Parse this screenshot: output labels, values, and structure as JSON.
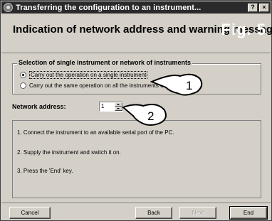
{
  "window": {
    "title": "Transferring the configuration to an instrument...",
    "help_label": "?",
    "close_label": "×"
  },
  "header": {
    "title": "Indication of network address and warning message",
    "figure_label": "Fig. 5"
  },
  "selection": {
    "legend": "Selection of single instrument or network of instruments",
    "options": [
      {
        "label": "Carry out the operation on a single instrument",
        "checked": true
      },
      {
        "label": "Carry out the same operation on all the instruments of network",
        "checked": false
      }
    ]
  },
  "network": {
    "label": "Network address:",
    "value": "1"
  },
  "steps": [
    "1.  Connect the instrument to an available serial port of the PC.",
    "2.  Supply the instrument and switch it on.",
    "3.  Press the 'End' key."
  ],
  "callouts": [
    "1",
    "2"
  ],
  "buttons": {
    "cancel": "Cancel",
    "back": "Back",
    "next": "Next",
    "end": "End"
  },
  "colors": {
    "dialog_face": "#d4d0c8",
    "titlebar": "#2a2a2a"
  }
}
